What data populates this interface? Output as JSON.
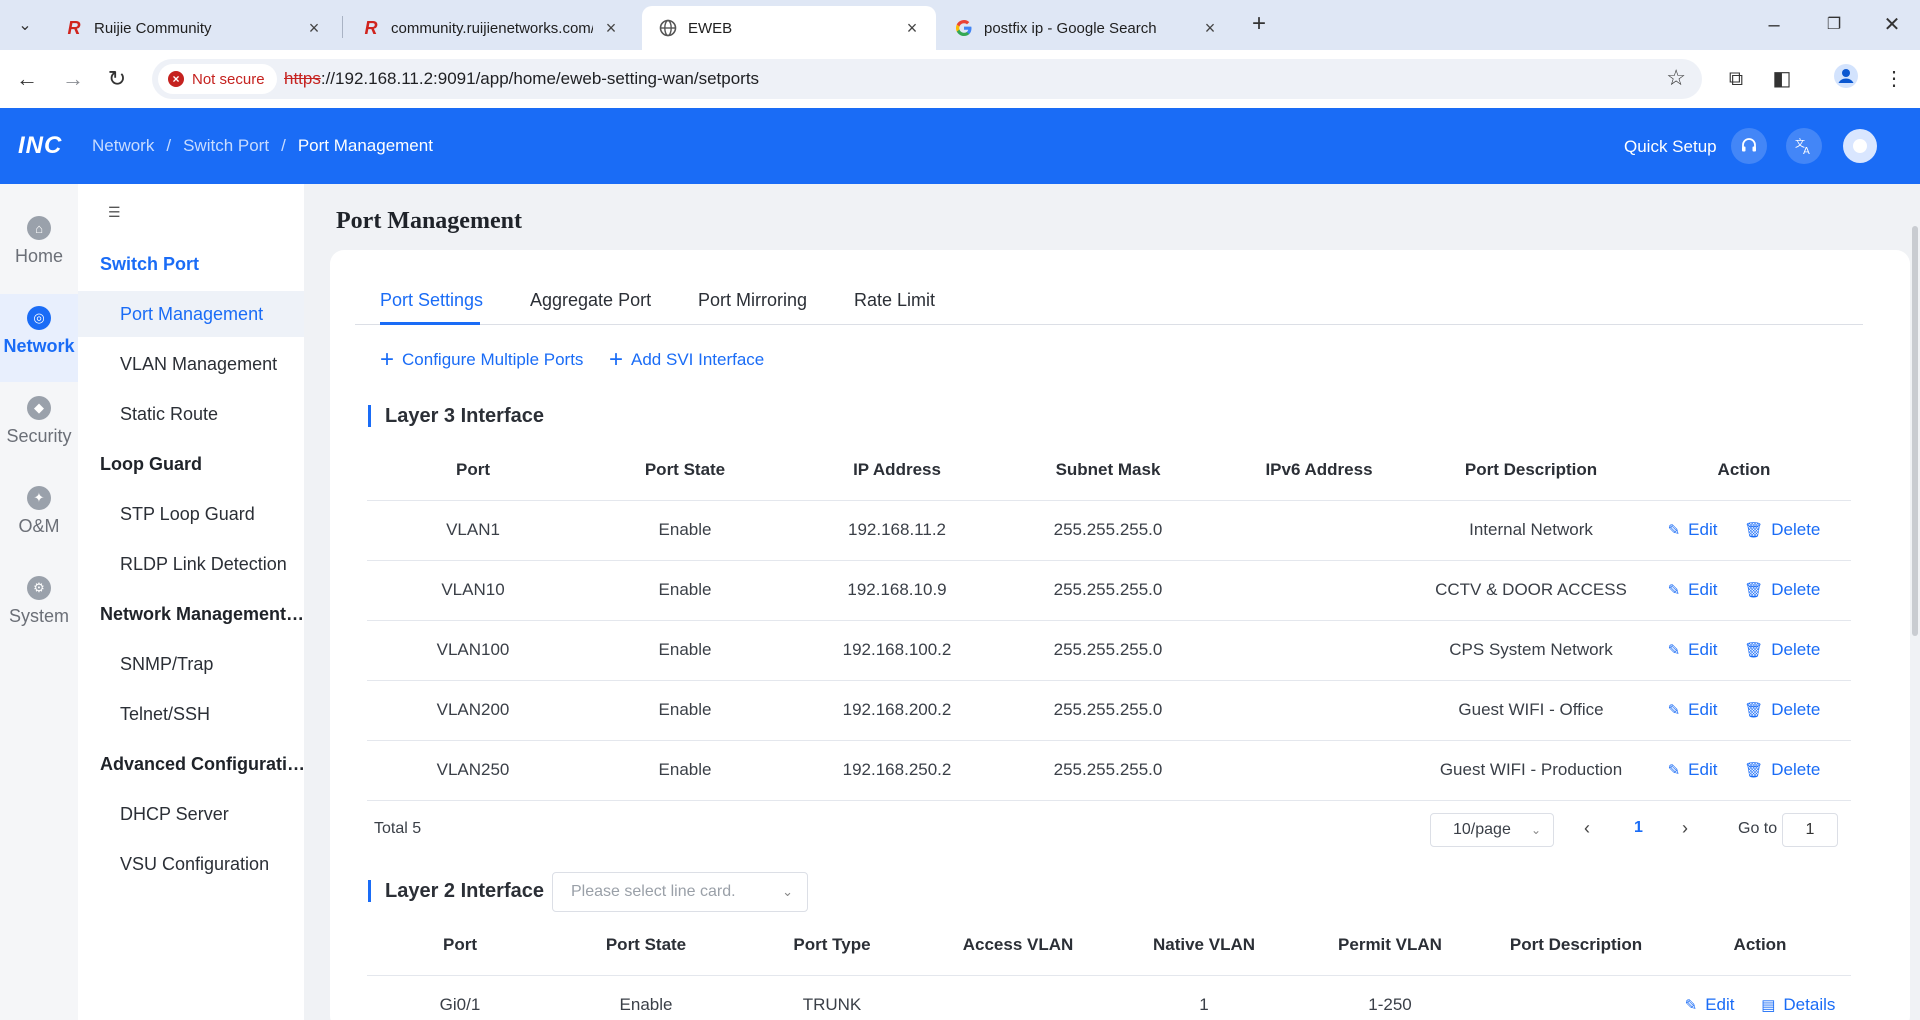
{
  "browser": {
    "tabs": [
      {
        "title": "Ruijie Community",
        "icon": "R"
      },
      {
        "title": "community.ruijienetworks.com/",
        "icon": "R"
      },
      {
        "title": "EWEB",
        "icon": "globe"
      },
      {
        "title": "postfix ip - Google Search",
        "icon": "G"
      }
    ],
    "security_label": "Not secure",
    "url_scheme": "https",
    "url_rest": "://192.168.11.2:9091/app/home/eweb-setting-wan/setports"
  },
  "header": {
    "logo": "INC",
    "breadcrumb": [
      "Network",
      "Switch Port",
      "Port Management"
    ],
    "quick_setup": "Quick Setup"
  },
  "rail": [
    {
      "label": "Home",
      "icon": "home-icon"
    },
    {
      "label": "Network",
      "icon": "globe-icon"
    },
    {
      "label": "Security",
      "icon": "shield-icon"
    },
    {
      "label": "O&M",
      "icon": "wrench-icon"
    },
    {
      "label": "System",
      "icon": "gear-icon"
    }
  ],
  "submenu": {
    "groups": [
      {
        "label": "Switch Port",
        "items": [
          "Port Management",
          "VLAN Management",
          "Static Route"
        ]
      },
      {
        "label": "Loop Guard",
        "items": [
          "STP Loop Guard",
          "RLDP Link Detection"
        ]
      },
      {
        "label": "Network Management ...",
        "items": [
          "SNMP/Trap",
          "Telnet/SSH"
        ]
      },
      {
        "label": "Advanced Configuration",
        "items": [
          "DHCP Server",
          "VSU Configuration"
        ]
      }
    ]
  },
  "main": {
    "page_title": "Port Management",
    "tabs": [
      "Port Settings",
      "Aggregate Port",
      "Port Mirroring",
      "Rate Limit"
    ],
    "actions": {
      "configure": "Configure Multiple Ports",
      "add_svi": "Add SVI Interface"
    },
    "layer3": {
      "title": "Layer 3 Interface",
      "columns": [
        "Port",
        "Port State",
        "IP Address",
        "Subnet Mask",
        "IPv6 Address",
        "Port Description",
        "Action"
      ],
      "rows": [
        {
          "port": "VLAN1",
          "state": "Enable",
          "ip": "192.168.11.2",
          "mask": "255.255.255.0",
          "ipv6": "",
          "desc": "Internal Network"
        },
        {
          "port": "VLAN10",
          "state": "Enable",
          "ip": "192.168.10.9",
          "mask": "255.255.255.0",
          "ipv6": "",
          "desc": "CCTV & DOOR ACCESS"
        },
        {
          "port": "VLAN100",
          "state": "Enable",
          "ip": "192.168.100.2",
          "mask": "255.255.255.0",
          "ipv6": "",
          "desc": "CPS System Network"
        },
        {
          "port": "VLAN200",
          "state": "Enable",
          "ip": "192.168.200.2",
          "mask": "255.255.255.0",
          "ipv6": "",
          "desc": "Guest WIFI - Office"
        },
        {
          "port": "VLAN250",
          "state": "Enable",
          "ip": "192.168.250.2",
          "mask": "255.255.255.0",
          "ipv6": "",
          "desc": "Guest WIFI - Production"
        }
      ],
      "edit": "Edit",
      "delete": "Delete"
    },
    "pagination": {
      "total": "Total 5",
      "page_size": "10/page",
      "current": "1",
      "goto_label": "Go to",
      "goto_value": "1"
    },
    "layer2": {
      "title": "Layer 2 Interface",
      "select_placeholder": "Please select line card.",
      "columns": [
        "Port",
        "Port State",
        "Port Type",
        "Access VLAN",
        "Native VLAN",
        "Permit VLAN",
        "Port Description",
        "Action"
      ],
      "rows": [
        {
          "port": "Gi0/1",
          "state": "Enable",
          "type": "TRUNK",
          "access": "",
          "native": "1",
          "permit": "1-250",
          "desc": ""
        }
      ],
      "edit": "Edit",
      "details": "Details"
    }
  },
  "colors": {
    "accent": "#1a6cf6",
    "danger": "#c5221f"
  }
}
